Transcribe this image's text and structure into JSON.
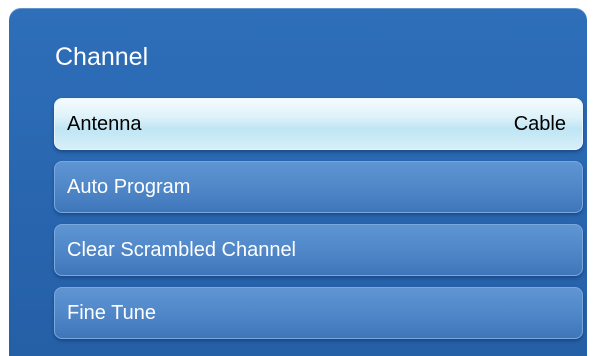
{
  "window": {
    "title": "Channel"
  },
  "menu": {
    "items": [
      {
        "label": "Antenna",
        "value": "Cable",
        "selected": true
      },
      {
        "label": "Auto Program"
      },
      {
        "label": "Clear Scrambled Channel"
      },
      {
        "label": "Fine Tune"
      }
    ]
  },
  "colors": {
    "panel_background": "#2a68b2",
    "item_background": "#4e86c8",
    "selected_item_background": "#d6eff9",
    "title_text": "#ffffff"
  }
}
